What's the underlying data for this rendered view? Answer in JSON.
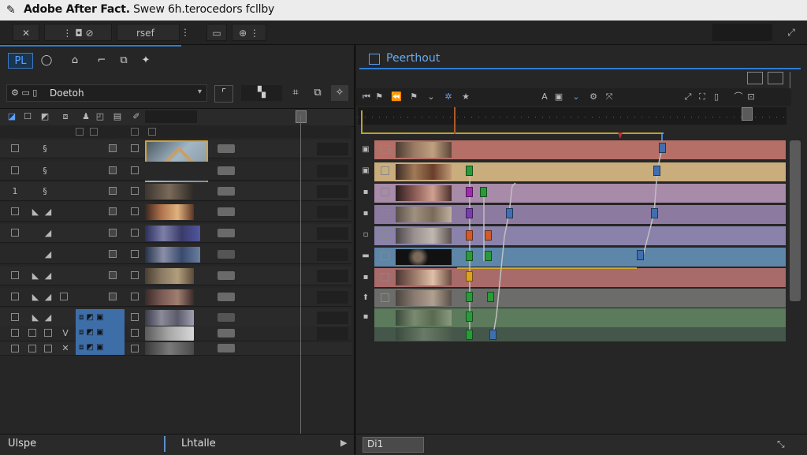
{
  "window": {
    "title_bold": "Adobe After Fact.",
    "title_rest": " Swew 6h.terocedors fcllby"
  },
  "toolbar": {
    "search_value": "rsef"
  },
  "left_panel": {
    "tools": [
      "PL"
    ],
    "name_field": "Doetoh",
    "rows": [
      {
        "index": "",
        "mode": "§"
      },
      {
        "index": "",
        "mode": "§"
      },
      {
        "index": "1",
        "mode": "§"
      },
      {
        "index": "",
        "mode": "◢"
      },
      {
        "index": "",
        "mode": "◢"
      },
      {
        "index": "",
        "mode": "◢"
      },
      {
        "index": "",
        "mode": "◢"
      },
      {
        "index": "",
        "mode": "◢"
      },
      {
        "index": "",
        "mode": "◢"
      },
      {
        "index": "",
        "mode": "V"
      },
      {
        "index": "",
        "mode": "✕"
      }
    ],
    "footer_left": "Ulspe",
    "footer_right": "Lhtalle"
  },
  "right_panel": {
    "comp_title": "Peerthout",
    "footer_value": "Di1"
  },
  "colors": {
    "accent": "#2f7bd8",
    "track_red": "#b56f66",
    "track_yellow": "#c9ad7c",
    "track_pink": "#a88aa9",
    "track_purple": "#8c7aa0",
    "track_lilac": "#8a82ab",
    "track_blue": "#5d86a8",
    "track_red2": "#a96a6a",
    "track_grey": "#6c6c6a",
    "track_green": "#5c7a5c"
  }
}
